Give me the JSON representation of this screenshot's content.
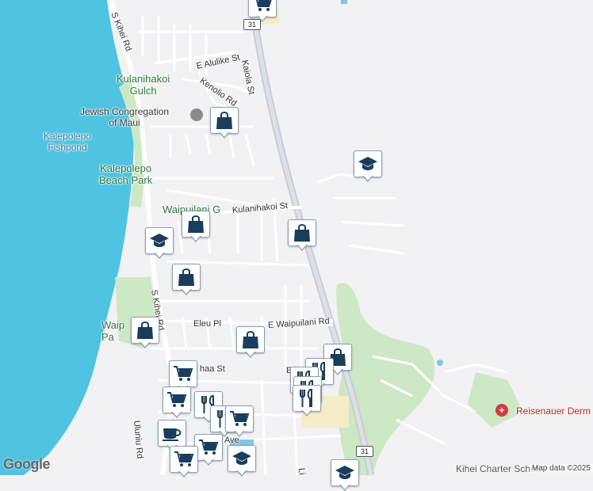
{
  "map": {
    "colors": {
      "water": "#4fc3e2",
      "land": "#f2f1f4",
      "road": "#ffffff",
      "highway": "#c8cdd5",
      "park": "#cde8c4",
      "pin_icon": "#1a3d5c"
    },
    "place_labels": {
      "kulanihakoi_gulch_1": "Kulanihakoi",
      "kulanihakoi_gulch_2": "Gulch",
      "jewish_1": "Jewish Congregation",
      "jewish_2": "of Maui",
      "kalepolepo_fishpond_1": "Kalepolepo",
      "kalepolepo_fishpond_2": "Fishpond",
      "kalepolepo_park_1": "Kalepolepo",
      "kalepolepo_park_2": "Beach Park",
      "waipuilani_g": "Waipuilani G",
      "waip_pa_1": "Waip",
      "waip_pa_2": "Pa",
      "reisenauer": "Reisenauer Derm",
      "kihei_charter": "Kihei Charter Schoo"
    },
    "road_labels": {
      "s_kihei_rd_top": "S Kihei Rd",
      "s_kihei_rd_mid": "S Kihei Rd",
      "e_alulike": "E Alulike St",
      "kaiola": "Kaiola St",
      "kenolio": "Kenolio Rd",
      "kulanihakoi_st": "Kulanihakoi St",
      "eleu_pl": "Eleu Pl",
      "e_waipuilani": "E Waipuilani Rd",
      "haa_st": "haa St",
      "uluniu": "Uluniu Rd",
      "ave": "Ave",
      "li": "Li",
      "e_small": "E"
    },
    "shields": {
      "top": "31",
      "bottom": "31"
    },
    "pins": [
      {
        "name": "shopping-cart-pin-top",
        "icon": "cart"
      },
      {
        "name": "shopping-bag-pin-jewish",
        "icon": "bag"
      },
      {
        "name": "school-pin-east",
        "icon": "school"
      },
      {
        "name": "shopping-bag-pin-highway",
        "icon": "bag"
      },
      {
        "name": "shopping-bag-pin-waipuilani",
        "icon": "bag"
      },
      {
        "name": "school-pin-west",
        "icon": "school"
      },
      {
        "name": "shopping-bag-pin-kihei-rd",
        "icon": "bag"
      },
      {
        "name": "shopping-bag-pin-waip-park",
        "icon": "bag"
      },
      {
        "name": "shopping-bag-pin-e-waipuilani",
        "icon": "bag"
      },
      {
        "name": "shopping-bag-pin-cluster",
        "icon": "bag"
      },
      {
        "name": "shopping-cart-pin-haa",
        "icon": "cart"
      },
      {
        "name": "restaurant-pin-cluster-1",
        "icon": "fork"
      },
      {
        "name": "restaurant-pin-cluster-2",
        "icon": "fork"
      },
      {
        "name": "restaurant-pin-cluster-3",
        "icon": "fork"
      },
      {
        "name": "shopping-cart-pin-south-1",
        "icon": "cart"
      },
      {
        "name": "restaurant-pin-south-1",
        "icon": "fork"
      },
      {
        "name": "restaurant-pin-south-2",
        "icon": "fork"
      },
      {
        "name": "restaurant-pin-south-3",
        "icon": "fork"
      },
      {
        "name": "cafe-pin",
        "icon": "cup"
      },
      {
        "name": "shopping-cart-pin-south-2",
        "icon": "cart"
      },
      {
        "name": "shopping-cart-pin-south-3",
        "icon": "cart"
      },
      {
        "name": "shopping-cart-pin-south-4",
        "icon": "cart"
      },
      {
        "name": "school-pin-kihei-charter",
        "icon": "school"
      },
      {
        "name": "school-pin-southeast",
        "icon": "school"
      }
    ],
    "attribution": {
      "logo": "Google",
      "copyright": "Map data ©2025"
    }
  }
}
